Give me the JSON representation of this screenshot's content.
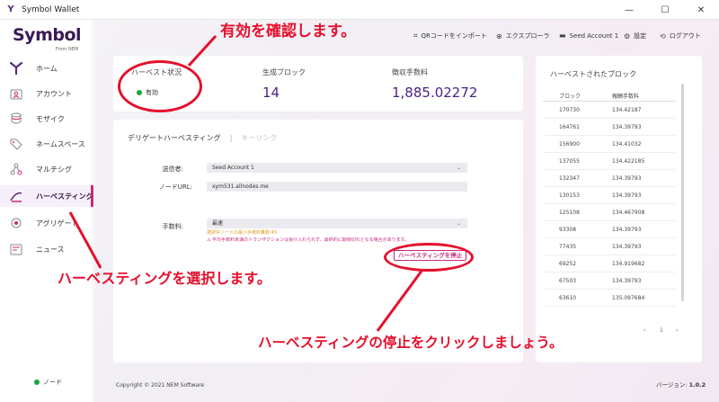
{
  "window": {
    "title": "Symbol Wallet",
    "controls": {
      "minimize": "—",
      "maximize": "☐",
      "close": "✕"
    }
  },
  "logo": {
    "text": "Symbol",
    "sub": "From NEM"
  },
  "sidebar": {
    "items": [
      {
        "label": "ホーム",
        "icon": "symbol-logo-icon"
      },
      {
        "label": "アカウント",
        "icon": "account-icon"
      },
      {
        "label": "モザイク",
        "icon": "mosaic-icon"
      },
      {
        "label": "ネームスペース",
        "icon": "tag-icon"
      },
      {
        "label": "マルチシグ",
        "icon": "multisig-icon"
      },
      {
        "label": "ハーベスティング",
        "icon": "harvest-icon",
        "active": true
      },
      {
        "label": "アグリゲート",
        "icon": "aggregate-icon"
      },
      {
        "label": "ニュース",
        "icon": "news-icon"
      }
    ],
    "node_label": "ノード"
  },
  "topnav": {
    "import_qr": "QRコードをインポート",
    "explorer": "エクスプローラ",
    "account": "Seed Account 1",
    "settings": "設定",
    "logout": "ログアウト"
  },
  "stats": {
    "status_label": "ハーベスト状況",
    "status_value": "有効",
    "blocks_label": "生成ブロック",
    "blocks_value": "14",
    "fees_label": "徴収手数料",
    "fees_value": "1,885.02272"
  },
  "harvest_form": {
    "tab_delegated": "デリゲートハーベスティング",
    "tab_separator": "|",
    "tab_keylink": "キーリンク",
    "sender_label": "送信者:",
    "sender_value": "Seed Account 1",
    "node_url_label": "ノードURL:",
    "node_url_value": "xym531.allnodes.me",
    "fee_label": "手数料:",
    "fee_value": "最速",
    "hint_min_fee": "選択中ノードの最小手数料乗数:45",
    "hint_warning": "⚠ 平均手数料未満のトランザクションは受け入れられず、最終的に期限切れとなる場合があります。",
    "stop_button": "ハーベスティングを停止"
  },
  "harvested": {
    "title": "ハーベストされたブロック",
    "columns": [
      "ブロック",
      "報酬手数料"
    ],
    "rows": [
      [
        "170730",
        "134.42187"
      ],
      [
        "164761",
        "134.39793"
      ],
      [
        "156900",
        "134.41032"
      ],
      [
        "137055",
        "134.422185"
      ],
      [
        "132347",
        "134.39793"
      ],
      [
        "130153",
        "134.39793"
      ],
      [
        "125108",
        "134.467908"
      ],
      [
        "93308",
        "134.39793"
      ],
      [
        "77435",
        "134.39793"
      ],
      [
        "69252",
        "134.919682"
      ],
      [
        "67503",
        "134.39793"
      ],
      [
        "63610",
        "135.097684"
      ]
    ],
    "pager": {
      "prev": "‹",
      "page": "1",
      "next": "›"
    }
  },
  "footer": {
    "copyright": "Copyright © 2021 NEM Software",
    "version_label": "バージョン: ",
    "version_value": "1.0.2"
  },
  "annotations": {
    "confirm": "有効を確認します。",
    "select": "ハーベスティングを選択します。",
    "click_stop": "ハーベスティングの停止をクリックしましょう。"
  },
  "colors": {
    "accent": "#c8287f",
    "brand_purple": "#4b1f86",
    "status_green": "#1aa53d",
    "annotation_red": "#e5102c"
  }
}
